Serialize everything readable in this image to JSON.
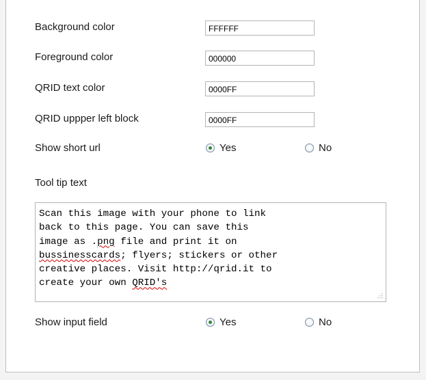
{
  "form": {
    "background_color": {
      "label": "Background color",
      "value": "FFFFFF"
    },
    "foreground_color": {
      "label": "Foreground color",
      "value": "000000"
    },
    "qrid_text_color": {
      "label": "QRID text color",
      "value": "0000FF"
    },
    "qrid_upper_left_block": {
      "label": "QRID uppper left block",
      "value": "0000FF"
    },
    "show_short_url": {
      "label": "Show short url",
      "yes": "Yes",
      "no": "No",
      "selected": "Yes"
    },
    "tooltip": {
      "label": "Tool tip text",
      "line1": "Scan this image with your phone to link",
      "line2": "back to this page. You can save this",
      "line3_a": "image as .",
      "line3_b": "png",
      "line3_c": " file and print it on",
      "line4_a": "bussinesscards",
      "line4_b": "; flyers; stickers or other",
      "line5": "creative places. Visit http://qrid.it to",
      "line6_a": "create your own ",
      "line6_b": "QRID's"
    },
    "show_input_field": {
      "label": "Show input field",
      "yes": "Yes",
      "no": "No",
      "selected": "Yes"
    }
  },
  "colors": {
    "radio_dot": "#2a8a3a",
    "spellcheck_underline": "#d40000",
    "border": "#b3b3b3"
  }
}
